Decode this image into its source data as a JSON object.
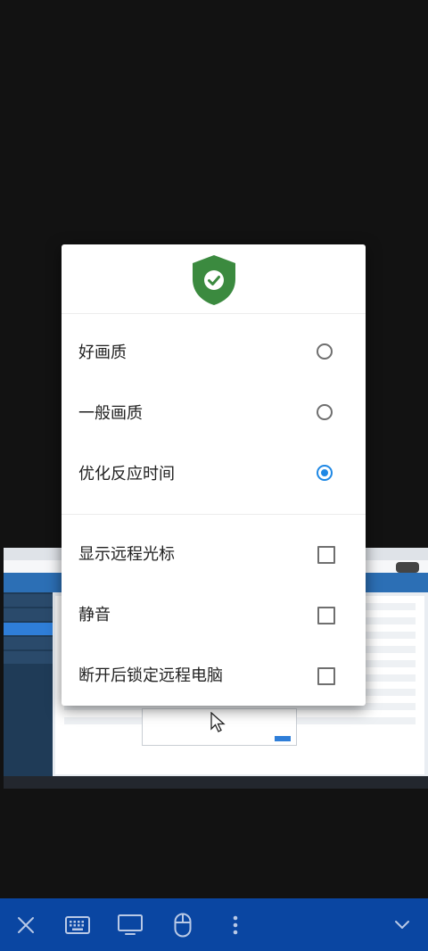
{
  "dialog": {
    "icon": "shield-check-icon",
    "accent_color": "#1e88e5",
    "shield_color": "#3b8a3f",
    "quality_options": [
      {
        "label": "好画质",
        "selected": false
      },
      {
        "label": "一般画质",
        "selected": false
      },
      {
        "label": "优化反应时间",
        "selected": true
      }
    ],
    "toggle_options": [
      {
        "label": "显示远程光标",
        "checked": false
      },
      {
        "label": "静音",
        "checked": false
      },
      {
        "label": "断开后锁定远程电脑",
        "checked": false
      }
    ]
  },
  "toolbar": {
    "background": "#0a46a2",
    "buttons": [
      "close-icon",
      "keyboard-icon",
      "monitor-icon",
      "mouse-icon",
      "more-vertical-icon",
      "chevron-down-icon"
    ]
  }
}
